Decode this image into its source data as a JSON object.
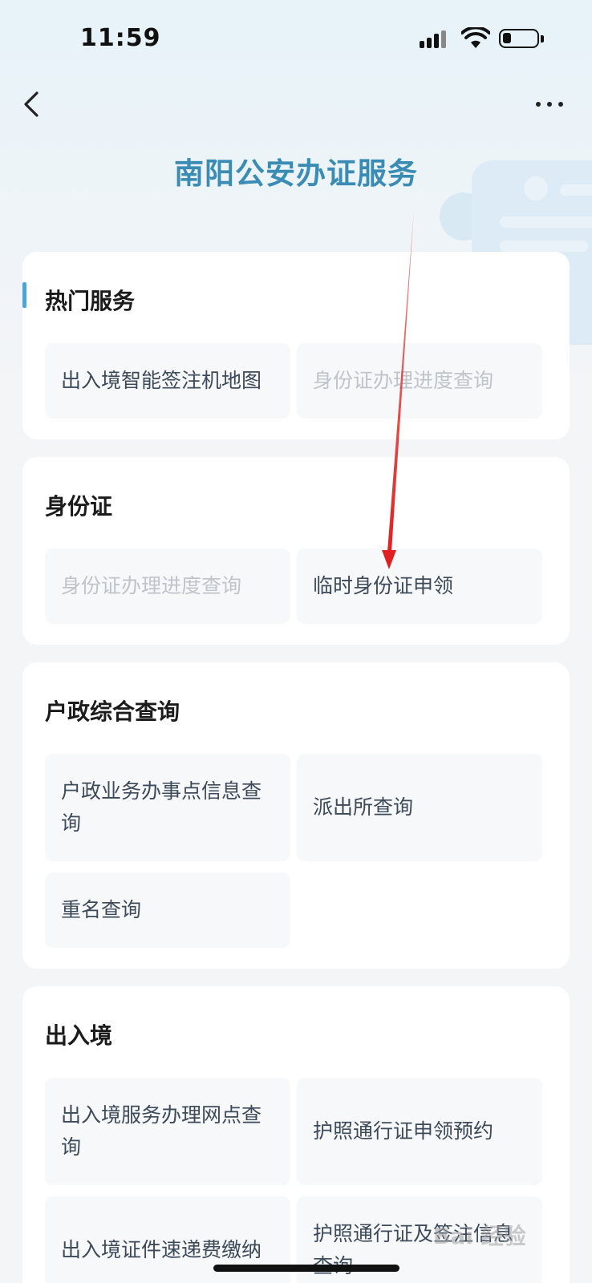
{
  "status_bar": {
    "time": "11:59"
  },
  "header": {
    "title": "南阳公安办证服务"
  },
  "sections": [
    {
      "title": "热门服务",
      "items": [
        {
          "label": "出入境智能签注机地图",
          "enabled": true
        },
        {
          "label": "身份证办理进度查询",
          "enabled": false
        }
      ]
    },
    {
      "title": "身份证",
      "items": [
        {
          "label": "身份证办理进度查询",
          "enabled": false
        },
        {
          "label": "临时身份证申领",
          "enabled": true
        }
      ]
    },
    {
      "title": "户政综合查询",
      "items": [
        {
          "label": "户政业务办事点信息查询",
          "enabled": true
        },
        {
          "label": "派出所查询",
          "enabled": true
        },
        {
          "label": "重名查询",
          "enabled": true
        }
      ]
    },
    {
      "title": "出入境",
      "items": [
        {
          "label": "出入境服务办理网点查询",
          "enabled": true
        },
        {
          "label": "护照通行证申领预约",
          "enabled": true
        },
        {
          "label": "出入境证件速递费缴纳",
          "enabled": true
        },
        {
          "label": "护照通行证及签注信息查询",
          "enabled": true
        }
      ]
    }
  ],
  "watermark": {
    "text": "Bai 经验"
  },
  "colors": {
    "title": "#3a8cb4",
    "accent": "#4aa6d6",
    "annotation": "#e02020"
  }
}
